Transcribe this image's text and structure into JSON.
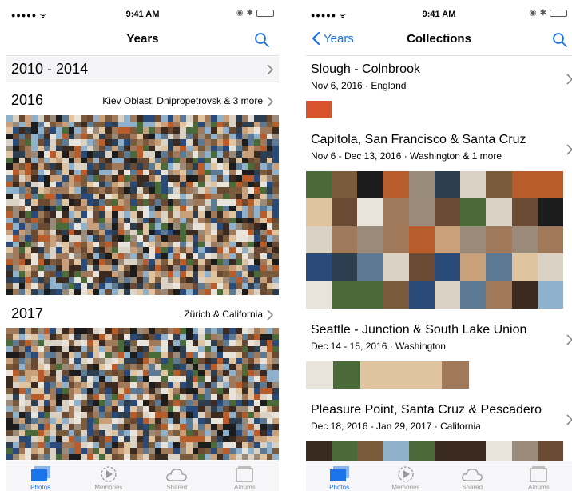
{
  "status_bar": {
    "signal": "●●●●● ᯤ",
    "time": "9:41 AM"
  },
  "left": {
    "nav_title": "Years",
    "year_range": "2010 - 2014",
    "years": [
      {
        "title": "2016",
        "subtitle": "Kiev Oblast, Dnipropetrovsk & 3 more"
      },
      {
        "title": "2017",
        "subtitle": "Zürich & California"
      }
    ]
  },
  "right": {
    "back_label": "Years",
    "nav_title": "Collections",
    "collections": [
      {
        "title": "Slough - Colnbrook",
        "subtitle": "Nov 6, 2016 · England"
      },
      {
        "title": "Capitola, San Francisco & Santa Cruz",
        "subtitle": "Nov 6 - Dec 13, 2016 · Washington & 1 more"
      },
      {
        "title": "Seattle - Junction & South Lake Union",
        "subtitle": "Dec 14 - 15, 2016 · Washington"
      },
      {
        "title": "Pleasure Point, Santa Cruz & Pescadero",
        "subtitle": "Dec 18, 2016 - Jan 29, 2017 · California"
      }
    ]
  },
  "tabs": [
    {
      "label": "Photos",
      "icon": "photos-icon",
      "active": true
    },
    {
      "label": "Memories",
      "icon": "memories-icon",
      "active": false
    },
    {
      "label": "Shared",
      "icon": "shared-cloud-icon",
      "active": false
    },
    {
      "label": "Albums",
      "icon": "albums-icon",
      "active": false
    }
  ],
  "colors": {
    "accent": "#1a73e8",
    "battery": "#33cc33"
  }
}
